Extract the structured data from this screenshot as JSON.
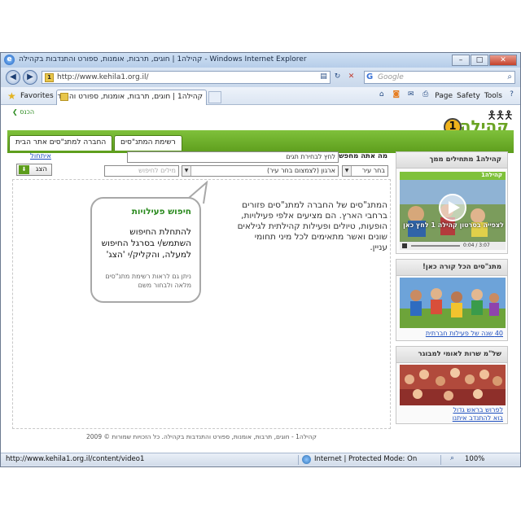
{
  "browser": {
    "window_title": "קהילה1 | חוגים, תרבות, אומנות, ספורט והתנדבות בקהילה - Windows Internet Explorer",
    "url": "http://www.kehila1.org.il/",
    "search_placeholder": "Google",
    "favorites_label": "Favorites",
    "tab_label": "קהילה1 | חוגים, תרבות, אומנות, ספורט והתנדבות...",
    "commands": [
      "Page",
      "Safety",
      "Tools"
    ],
    "help_icon": "help-icon"
  },
  "site": {
    "back_link": "הכנס",
    "logo_text": "קהילה",
    "logo_number": "1",
    "nav": {
      "tab_list": "רשימת המתנ\"סים",
      "tab_company": "החברה למתנ\"סים אתר הבית"
    },
    "search": {
      "question_label": "מה אתה מחפש?",
      "query_value": "לחץ לבחירת תגים",
      "city_select": "בחר עיר",
      "org_select": "ארגון (לצמצום בחר עיר)",
      "keywords_placeholder": "מילים לחיפוש",
      "cancel_link": "איתחול",
      "show_button": "הצג"
    },
    "bubble": {
      "title": "חיפוש פעילויות",
      "text": "להתחלת החיפוש השתמש/י בסרגל החיפוש למעלה, והקליק/י 'הצג'",
      "note": "ניתן גם לראות רשימת מתנ\"סים מלאה ולבחור משם"
    },
    "intro": "המתנ\"סים של החברה למתנ\"סים פזורים ברחבי הארץ. הם מציעים אלפי פעילויות, הופעות, טיולים ופעילות קהילתית לגילאים שונים ואשר מתאימים לכל מיני תחומי עניין.",
    "sidebar": {
      "box1": {
        "title": "קהילה1 מתחילים ממך",
        "video_caption": "לצפייה בסרטון קהילה 1 לחץ כאן",
        "video_time": "0:04 / 3:07",
        "logo_mini": "קהילה1"
      },
      "box2": {
        "title": "מתנ\"סים הכל קורה כאן!",
        "link": "40 שנה של פעילות חברתית"
      },
      "box3": {
        "title": "של\"מ שרות לאומי למבוגר",
        "link_line1": "לפרוש בראש גדול",
        "link_line2": "בוא להתנדב איתנו"
      }
    },
    "footer": "קהילה1 - חוגים, תרבות, אומנות, ספורט והתנדבות בקהילה. כל הזכויות שמורות © 2009"
  },
  "status": {
    "url": "http://www.kehila1.org.il/content/video1",
    "zone": "Internet | Protected Mode: On",
    "zoom": "100%"
  },
  "colors": {
    "brand_green": "#6aa323",
    "link_blue": "#1e4fbf",
    "logo_orange": "#f0b31c"
  }
}
